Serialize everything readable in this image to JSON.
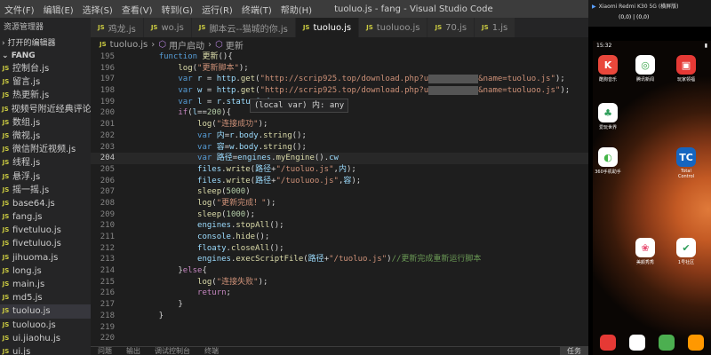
{
  "menu": [
    "文件(F)",
    "编辑(E)",
    "选择(S)",
    "查看(V)",
    "转到(G)",
    "运行(R)",
    "终端(T)",
    "帮助(H)"
  ],
  "window_title": "tuoluo.js - fang - Visual Studio Code",
  "sidebar": {
    "header": "资源管理器",
    "open_editors": "打开的编辑器",
    "folder": "FANG",
    "files": [
      "控制台.js",
      "留言.js",
      "热更新.js",
      "视频号附近经典评论.js",
      "数组.js",
      "微视.js",
      "微信附近视频.js",
      "线程.js",
      "悬浮.js",
      "摇一摇.js",
      "base64.js",
      "fang.js",
      "fivetuluo.js",
      "fivetuluo.js",
      "jihuoma.js",
      "long.js",
      "main.js",
      "md5.js",
      "tuoluo.js",
      "tuoluoo.js",
      "ui.jiaohu.js",
      "ui.js"
    ],
    "active_index": 18
  },
  "tabs": [
    "鸡龙.js",
    "wo.js",
    "脚本云--猫城的你.js",
    "tuoluo.js",
    "tuoluoo.js",
    "70.js",
    "1.js"
  ],
  "active_tab": 3,
  "breadcrumb": {
    "file": "tuoluo.js",
    "sym1": "用户启动",
    "sym2": "更新"
  },
  "code_lines": [
    {
      "n": "195",
      "html": "    <span class=\"kwb\">function</span> <span class=\"fn\">更新</span>(){"
    },
    {
      "n": "196",
      "html": "        <span class=\"fn\">log</span>(<span class=\"str\">\"更新脚本\"</span>);"
    },
    {
      "n": "197",
      "html": "        <span class=\"kwb\">var</span> <span class=\"var\">r</span> = <span class=\"var\">http</span>.<span class=\"fn\">get</span>(<span class=\"str\">\"http://scrip925.top/download.php?u</span><span class=\"redact\"></span><span class=\"str\">&name=tuoluo.js\"</span>);"
    },
    {
      "n": "198",
      "html": "        <span class=\"kwb\">var</span> <span class=\"var\">w</span> = <span class=\"var\">http</span>.<span class=\"fn\">get</span>(<span class=\"str\">\"http://scrip925.top/download.php?u</span><span class=\"redact\"></span><span class=\"str\">&name=tuoluoo.js\"</span>);"
    },
    {
      "n": "199",
      "html": "        <span class=\"kwb\">var</span> <span class=\"var\">l</span> = <span class=\"var\">r</span>.<span class=\"var\">statusCode</span>;"
    },
    {
      "n": "200",
      "html": "        <span class=\"kw\">if</span>(<span class=\"var\">l</span>==<span class=\"num\">200</span>){"
    },
    {
      "n": "201",
      "html": "            <span class=\"fn\">log</span>(<span class=\"str\">\"连接成功\"</span>);"
    },
    {
      "n": "202",
      "html": "            <span class=\"kwb\">var</span> <span class=\"var\">内</span>=<span class=\"var\">r</span>.<span class=\"var\">body</span>.<span class=\"fn\">string</span>();"
    },
    {
      "n": "203",
      "html": "            <span class=\"kwb\">var</span> <span class=\"var\">容</span>=<span class=\"var\">w</span>.<span class=\"var\">body</span>.<span class=\"fn\">string</span>();"
    },
    {
      "n": "204",
      "html": "            <span class=\"kwb\">var</span> <span class=\"var\">路径</span>=<span class=\"var\">engines</span>.<span class=\"fn\">myEngine</span>().<span class=\"var\">cw</span>"
    },
    {
      "n": "205",
      "html": "            <span class=\"var\">files</span>.<span class=\"fn\">write</span>(<span class=\"var\">路径</span>+<span class=\"str\">\"/tuoluo.js\"</span>,<span class=\"var\">内</span>);"
    },
    {
      "n": "206",
      "html": "            <span class=\"var\">files</span>.<span class=\"fn\">write</span>(<span class=\"var\">路径</span>+<span class=\"str\">\"/tuoluoo.js\"</span>,<span class=\"var\">容</span>);"
    },
    {
      "n": "207",
      "html": "            <span class=\"fn\">sleep</span>(<span class=\"num\">5000</span>)"
    },
    {
      "n": "208",
      "html": "            <span class=\"fn\">log</span>(<span class=\"str\">\"更新完成！\"</span>);"
    },
    {
      "n": "209",
      "html": "            <span class=\"fn\">sleep</span>(<span class=\"num\">1000</span>);"
    },
    {
      "n": "210",
      "html": "            <span class=\"var\">engines</span>.<span class=\"fn\">stopAll</span>();"
    },
    {
      "n": "211",
      "html": "            <span class=\"var\">console</span>.<span class=\"fn\">hide</span>();"
    },
    {
      "n": "212",
      "html": "            <span class=\"var\">floaty</span>.<span class=\"fn\">closeAll</span>();"
    },
    {
      "n": "213",
      "html": "            <span class=\"var\">engines</span>.<span class=\"fn\">execScriptFile</span>(<span class=\"var\">路径</span>+<span class=\"str\">\"/tuoluo.js\"</span>)<span class=\"cm\">//更新完成重新运行脚本</span>"
    },
    {
      "n": "214",
      "html": "        }<span class=\"kw\">else</span>{"
    },
    {
      "n": "215",
      "html": "            <span class=\"fn\">log</span>(<span class=\"str\">\"连接失败\"</span>);"
    },
    {
      "n": "216",
      "html": "            <span class=\"kw\">return</span>;"
    },
    {
      "n": "217",
      "html": "        }"
    },
    {
      "n": "218",
      "html": "    }"
    },
    {
      "n": "219",
      "html": ""
    },
    {
      "n": "220",
      "html": ""
    }
  ],
  "current_line": "204",
  "hover_text": "(local var) 内: any",
  "panel": {
    "tab1": "问题",
    "tab2": "输出",
    "tab3": "调试控制台",
    "tab4": "终端",
    "task": "任务"
  },
  "phone": {
    "title": "Xiaomi Redmi K30 5G (横屏版)",
    "coords": "(0,0) | (0,0)",
    "time": "15:32",
    "apps": [
      {
        "label": "酷狗音乐",
        "glyph": "K",
        "bg": "#e9473b",
        "fg": "#fff"
      },
      {
        "label": "腾讯新闻",
        "glyph": "◎",
        "bg": "#ffffff",
        "fg": "#3aa64a"
      },
      {
        "label": "玩家领福",
        "glyph": "▣",
        "bg": "#e53935",
        "fg": "#fff"
      },
      {
        "label": "爱玩世界",
        "glyph": "♣",
        "bg": "#ffffff",
        "fg": "#2e9e5b"
      },
      {
        "label": "360手机助手",
        "glyph": "◐",
        "bg": "#ffffff",
        "fg": "#45b649"
      },
      {
        "label": "Total Control",
        "glyph": "TC",
        "bg": "#1565c0",
        "fg": "#fff"
      },
      {
        "label": "美颜秀秀",
        "glyph": "❀",
        "bg": "#ffffff",
        "fg": "#e84a6f"
      },
      {
        "label": "1号社区",
        "glyph": "✔",
        "bg": "#ffffff",
        "fg": "#2e9e5b"
      }
    ]
  }
}
